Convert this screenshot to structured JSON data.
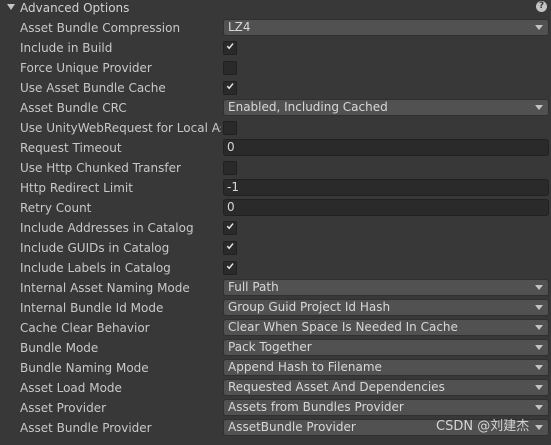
{
  "header": {
    "title": "Advanced Options",
    "help_icon": "help-icon"
  },
  "settings": [
    {
      "label": "Asset Bundle Compression",
      "type": "dropdown",
      "value": "LZ4"
    },
    {
      "label": "Include in Build",
      "type": "checkbox",
      "checked": true
    },
    {
      "label": "Force Unique Provider",
      "type": "checkbox",
      "checked": false
    },
    {
      "label": "Use Asset Bundle Cache",
      "type": "checkbox",
      "checked": true
    },
    {
      "label": "Asset Bundle CRC",
      "type": "dropdown",
      "value": "Enabled, Including Cached"
    },
    {
      "label": "Use UnityWebRequest for Local Ass",
      "type": "checkbox",
      "checked": false
    },
    {
      "label": "Request Timeout",
      "type": "text",
      "value": "0"
    },
    {
      "label": "Use Http Chunked Transfer",
      "type": "checkbox",
      "checked": false
    },
    {
      "label": "Http Redirect Limit",
      "type": "text",
      "value": "-1"
    },
    {
      "label": "Retry Count",
      "type": "text",
      "value": "0"
    },
    {
      "label": "Include Addresses in Catalog",
      "type": "checkbox",
      "checked": true
    },
    {
      "label": "Include GUIDs in Catalog",
      "type": "checkbox",
      "checked": true
    },
    {
      "label": "Include Labels in Catalog",
      "type": "checkbox",
      "checked": true
    },
    {
      "label": "Internal Asset Naming Mode",
      "type": "dropdown",
      "value": "Full Path"
    },
    {
      "label": "Internal Bundle Id Mode",
      "type": "dropdown",
      "value": "Group Guid Project Id Hash"
    },
    {
      "label": "Cache Clear Behavior",
      "type": "dropdown",
      "value": "Clear When Space Is Needed In Cache"
    },
    {
      "label": "Bundle Mode",
      "type": "dropdown",
      "value": "Pack Together"
    },
    {
      "label": "Bundle Naming Mode",
      "type": "dropdown",
      "value": "Append Hash to Filename"
    },
    {
      "label": "Asset Load Mode",
      "type": "dropdown",
      "value": "Requested Asset And Dependencies"
    },
    {
      "label": "Asset Provider",
      "type": "dropdown",
      "value": "Assets from Bundles Provider"
    },
    {
      "label": "Asset Bundle Provider",
      "type": "dropdown",
      "value": "AssetBundle Provider"
    }
  ],
  "watermark": "CSDN @刘建杰"
}
